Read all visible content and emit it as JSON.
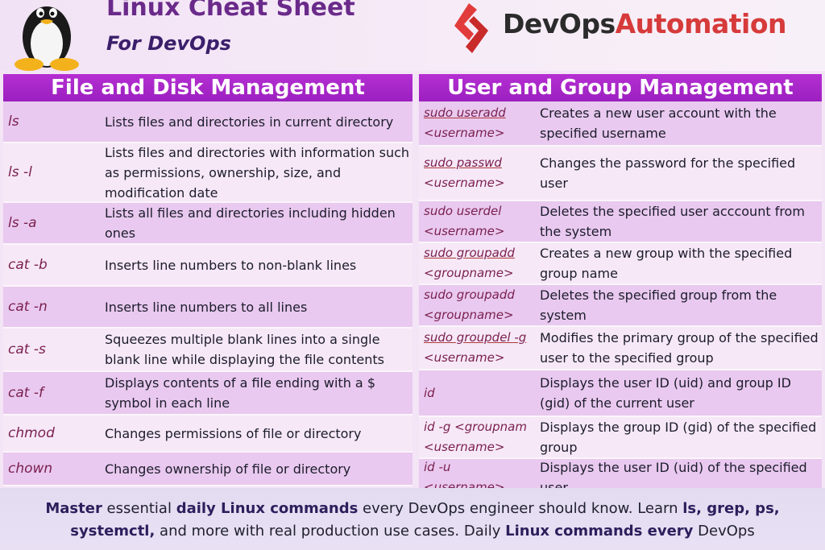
{
  "header": {
    "title": "Linux Cheat Sheet",
    "subtitle": "For DevOps",
    "brand_part1": "DevOps",
    "brand_part2": "Automation"
  },
  "left": {
    "heading": "File and Disk Management",
    "rows": [
      {
        "cmd": "ls",
        "desc": "Lists files and directories in current directory"
      },
      {
        "cmd": "ls -l",
        "desc": "Lists files and directories with information such as permissions, ownership, size, and modification date"
      },
      {
        "cmd": "ls -a",
        "desc": "Lists all files and directories including hidden ones"
      },
      {
        "cmd": "cat -b",
        "desc": "Inserts line numbers to non-blank lines"
      },
      {
        "cmd": "cat -n",
        "desc": "Inserts line numbers to all lines"
      },
      {
        "cmd": "cat -s",
        "desc": "Squeezes multiple blank lines into a single blank line while displaying the file contents"
      },
      {
        "cmd": "cat -f",
        "desc": "Displays contents of a file ending with a $ symbol in each line"
      },
      {
        "cmd": "chmod",
        "desc": "Changes permissions of file or directory"
      },
      {
        "cmd": "chown",
        "desc": "Changes ownership of file or directory"
      }
    ]
  },
  "right": {
    "heading": "User and Group Management",
    "rows": [
      {
        "cmd1": "sudo useradd",
        "cmd2": "<username>",
        "desc": "Creates a new user account with the specified username"
      },
      {
        "cmd1": "sudo passwd",
        "cmd2": "<username>",
        "desc": "Changes the password for the specified user"
      },
      {
        "cmd1": "sudo userdel",
        "cmd2": "<username>",
        "desc": "Deletes the specified user acccount from the system"
      },
      {
        "cmd1": "sudo groupadd",
        "cmd2": "<groupname>",
        "desc": "Creates a new group with the specified group name"
      },
      {
        "cmd1": "sudo groupadd",
        "cmd2": "<groupname>",
        "desc": "Deletes the specified group from the system"
      },
      {
        "cmd1": "sudo groupdel -g",
        "cmd2": "<username>",
        "desc": "Modifies the primary group of the specified user to the specified group"
      },
      {
        "cmd1": "id",
        "cmd2": "",
        "desc": "Displays the user ID (uid) and group ID (gid) of the current user"
      },
      {
        "cmd1": "id -g <groupnam",
        "cmd2": "<username>",
        "desc": "Displays the group ID (gid) of the specified group"
      },
      {
        "cmd1": "id -u",
        "cmd2": "<username>",
        "desc": "Displays the user ID (uid) of the specified user"
      }
    ]
  },
  "footer": {
    "b1": "Master",
    "t1": " essential ",
    "b2": "daily Linux commands",
    "t2": " every DevOps engineer should know. Learn ",
    "b3": "ls, grep, ps,",
    "b4": "systemctl,",
    "t3": " and more with real production use cases. Daily ",
    "b5": "Linux commands every",
    "t4": " DevOps"
  }
}
